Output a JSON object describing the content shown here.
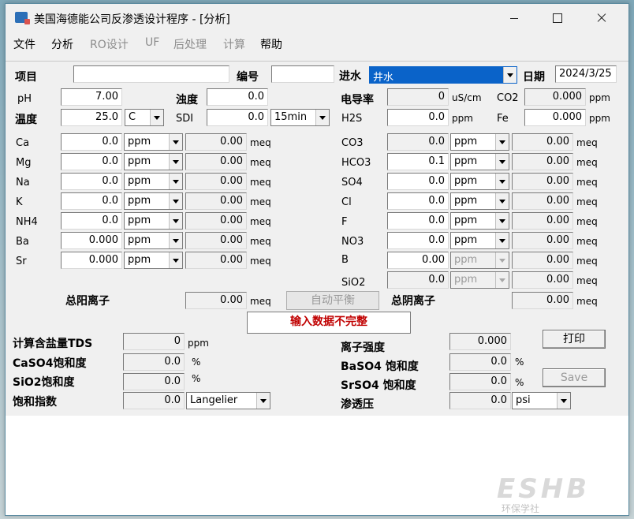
{
  "window": {
    "title": "美国海德能公司反渗透设计程序 - [分析]"
  },
  "menu": [
    {
      "label": "文件",
      "enabled": true
    },
    {
      "label": "分析",
      "enabled": true
    },
    {
      "label": "RO设计",
      "enabled": false
    },
    {
      "label": "UF",
      "enabled": false
    },
    {
      "label": "后处理",
      "enabled": false
    },
    {
      "label": "计算",
      "enabled": false
    },
    {
      "label": "帮助",
      "enabled": true
    }
  ],
  "header": {
    "project_label": "项目",
    "project_value": "",
    "number_label": "编号",
    "number_value": "",
    "feed_label": "进水",
    "feed_value": "井水",
    "date_label": "日期",
    "date_value": "2024/3/25"
  },
  "params": {
    "ph_label": "pH",
    "ph_value": "7.00",
    "turbidity_label": "浊度",
    "turbidity_value": "0.0",
    "conductivity_label": "电导率",
    "conductivity_value": "0",
    "conductivity_unit": "uS/cm",
    "co2_label": "CO2",
    "co2_value": "0.000",
    "co2_unit": "ppm",
    "temp_label": "温度",
    "temp_value": "25.0",
    "temp_unit": "C",
    "sdi_label": "SDI",
    "sdi_value": "0.0",
    "sdi_period": "15min",
    "h2s_label": "H2S",
    "h2s_value": "0.0",
    "h2s_unit": "ppm",
    "fe_label": "Fe",
    "fe_value": "0.000",
    "fe_unit": "ppm"
  },
  "cations": [
    {
      "name": "Ca",
      "value": "0.0",
      "unit": "ppm",
      "meq": "0.00",
      "meq_unit": "meq"
    },
    {
      "name": "Mg",
      "value": "0.0",
      "unit": "ppm",
      "meq": "0.00",
      "meq_unit": "meq"
    },
    {
      "name": "Na",
      "value": "0.0",
      "unit": "ppm",
      "meq": "0.00",
      "meq_unit": "meq"
    },
    {
      "name": "K",
      "value": "0.0",
      "unit": "ppm",
      "meq": "0.00",
      "meq_unit": "meq"
    },
    {
      "name": "NH4",
      "value": "0.0",
      "unit": "ppm",
      "meq": "0.00",
      "meq_unit": "meq"
    },
    {
      "name": "Ba",
      "value": "0.000",
      "unit": "ppm",
      "meq": "0.00",
      "meq_unit": "meq"
    },
    {
      "name": "Sr",
      "value": "0.000",
      "unit": "ppm",
      "meq": "0.00",
      "meq_unit": "meq"
    }
  ],
  "anions": [
    {
      "name": "CO3",
      "value": "0.0",
      "unit": "ppm",
      "meq": "0.00",
      "meq_unit": "meq",
      "disabled": false,
      "readonly": true
    },
    {
      "name": "HCO3",
      "value": "0.1",
      "unit": "ppm",
      "meq": "0.00",
      "meq_unit": "meq",
      "disabled": false,
      "readonly": false
    },
    {
      "name": "SO4",
      "value": "0.0",
      "unit": "ppm",
      "meq": "0.00",
      "meq_unit": "meq",
      "disabled": false,
      "readonly": false
    },
    {
      "name": "Cl",
      "value": "0.0",
      "unit": "ppm",
      "meq": "0.00",
      "meq_unit": "meq",
      "disabled": false,
      "readonly": false
    },
    {
      "name": "F",
      "value": "0.0",
      "unit": "ppm",
      "meq": "0.00",
      "meq_unit": "meq",
      "disabled": false,
      "readonly": false
    },
    {
      "name": "NO3",
      "value": "0.0",
      "unit": "ppm",
      "meq": "0.00",
      "meq_unit": "meq",
      "disabled": false,
      "readonly": false
    },
    {
      "name": "B",
      "value": "0.00",
      "unit": "ppm",
      "meq": "0.00",
      "meq_unit": "meq",
      "disabled": true,
      "readonly": false
    },
    {
      "name": "SiO2",
      "value": "0.0",
      "unit": "ppm",
      "meq": "0.00",
      "meq_unit": "meq",
      "disabled": true,
      "readonly": true
    }
  ],
  "totals": {
    "cation_label": "总阳离子",
    "cation_value": "0.00",
    "cation_unit": "meq",
    "balance_button": "自动平衡",
    "anion_label": "总阴离子",
    "anion_value": "0.00",
    "anion_unit": "meq",
    "warning": "输入数据不完整"
  },
  "results": {
    "tds_label": "计算含盐量TDS",
    "tds_value": "0",
    "tds_unit": "ppm",
    "caso4_label": "CaSO4饱和度",
    "caso4_value": "0.0",
    "caso4_unit": "%",
    "sio2_label": "SiO2饱和度",
    "sio2_value": "0.0",
    "sio2_unit": "%",
    "index_label": "饱和指数",
    "index_value": "0.0",
    "index_type": "Langelier",
    "ionic_label": "离子强度",
    "ionic_value": "0.000",
    "baso4_label": "BaSO4 饱和度",
    "baso4_value": "0.0",
    "baso4_unit": "%",
    "srso4_label": "SrSO4 饱和度",
    "srso4_value": "0.0",
    "srso4_unit": "%",
    "osmotic_label": "渗透压",
    "osmotic_value": "0.0",
    "osmotic_unit": "psi",
    "print_button": "打印",
    "save_button": "Save"
  },
  "watermark": {
    "logo": "ESHB",
    "subtitle": "环保学社"
  }
}
